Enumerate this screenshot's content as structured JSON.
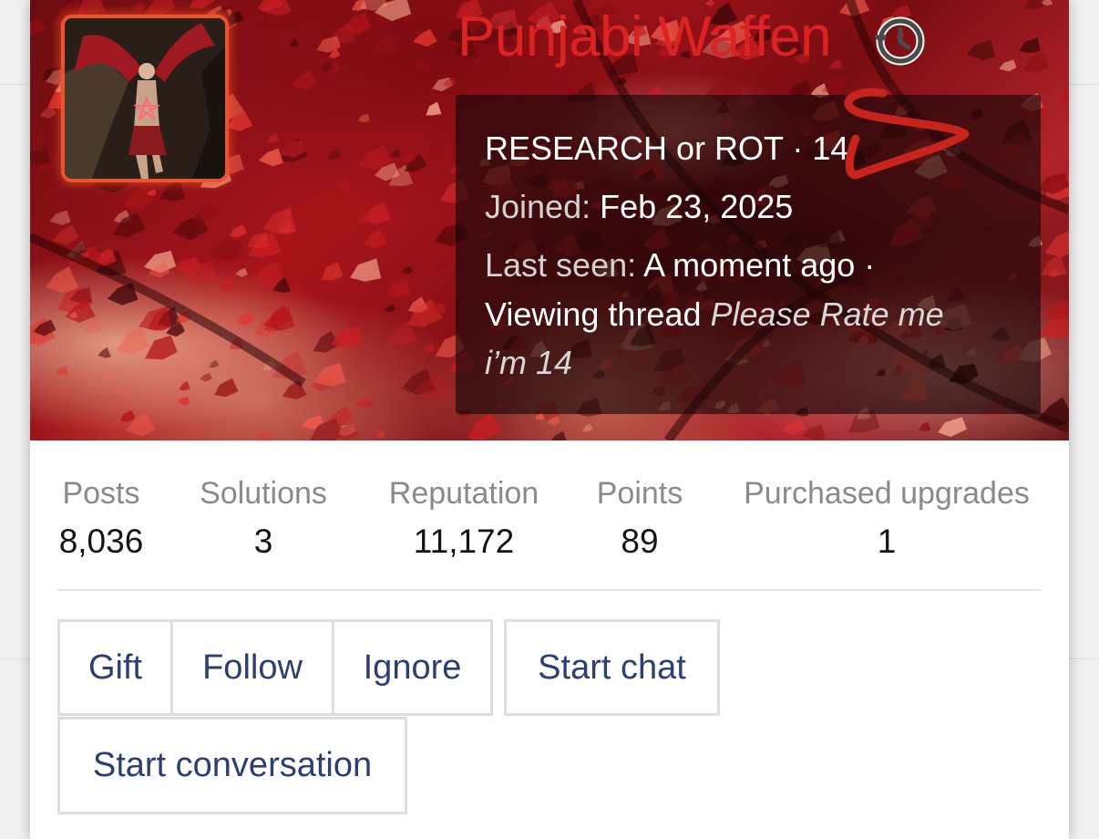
{
  "profile": {
    "username": "Punjabi Waffen",
    "history_icon": "history-icon",
    "avatar_icon": "winged-demon-avatar",
    "info": {
      "title_line": "RESEARCH or ROT · 14",
      "joined_label": "Joined:",
      "joined_value": "Feb 23, 2025",
      "last_seen_label": "Last seen:",
      "last_seen_value": "A moment ago ·",
      "viewing_prefix": "Viewing thread",
      "viewing_thread_part1": "Please Rate me",
      "viewing_thread_part2": "i’m 14"
    }
  },
  "stats": [
    {
      "label": "Posts",
      "value": "8,036"
    },
    {
      "label": "Solutions",
      "value": "3"
    },
    {
      "label": "Reputation",
      "value": "11,172"
    },
    {
      "label": "Points",
      "value": "89"
    },
    {
      "label": "Purchased upgrades",
      "value": "1"
    }
  ],
  "actions": {
    "gift": "Gift",
    "follow": "Follow",
    "ignore": "Ignore",
    "start_chat": "Start chat",
    "start_conversation": "Start conversation"
  },
  "colors": {
    "username": "#dc2323",
    "button_text": "#2c3e72",
    "avatar_border": "#e8542c",
    "annotation": "#c8231c"
  }
}
